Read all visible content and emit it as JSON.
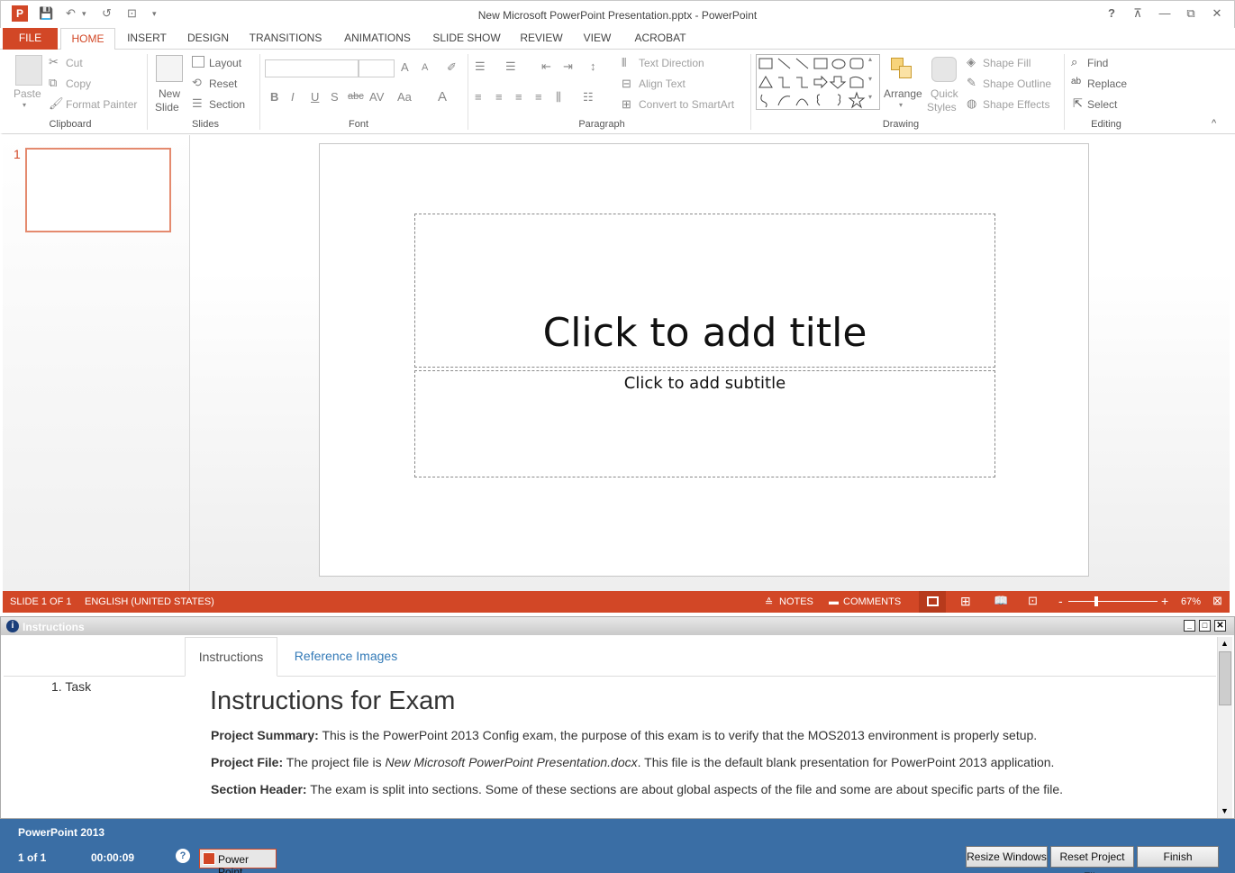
{
  "window": {
    "title": "New Microsoft PowerPoint Presentation.pptx - PowerPoint",
    "help": "?",
    "ribbon_display": "⊼",
    "minimize": "—",
    "restore": "⧉",
    "close": "✕"
  },
  "qat": {
    "app": "P",
    "save": "💾",
    "undo": "↶",
    "undo_arrow": "▾",
    "redo": "↺",
    "present": "⊡",
    "customize": "▾"
  },
  "tabs": [
    {
      "label": "FILE"
    },
    {
      "label": "HOME"
    },
    {
      "label": "INSERT"
    },
    {
      "label": "DESIGN"
    },
    {
      "label": "TRANSITIONS"
    },
    {
      "label": "ANIMATIONS"
    },
    {
      "label": "SLIDE SHOW"
    },
    {
      "label": "REVIEW"
    },
    {
      "label": "VIEW"
    },
    {
      "label": "ACROBAT"
    }
  ],
  "ribbon": {
    "clipboard": {
      "paste": "Paste",
      "cut": "Cut",
      "copy": "Copy",
      "format_painter": "Format Painter",
      "group": "Clipboard"
    },
    "slides": {
      "new_slide_line1": "New",
      "new_slide_line2": "Slide",
      "layout": "Layout",
      "reset": "Reset",
      "section": "Section",
      "group": "Slides"
    },
    "font": {
      "group": "Font",
      "bold": "B",
      "italic": "I",
      "underline": "U",
      "shadow": "S",
      "strike": "abc",
      "spacing": "AV",
      "case": "Aa",
      "color": "A",
      "grow": "A",
      "shrink": "A",
      "clear": "✐"
    },
    "paragraph": {
      "text_direction": "Text Direction",
      "align_text": "Align Text",
      "smartart": "Convert to SmartArt",
      "group": "Paragraph"
    },
    "drawing": {
      "arrange": "Arrange",
      "quick_styles_line1": "Quick",
      "quick_styles_line2": "Styles",
      "shape_fill": "Shape Fill",
      "shape_outline": "Shape Outline",
      "shape_effects": "Shape Effects",
      "group": "Drawing"
    },
    "editing": {
      "find": "Find",
      "replace": "Replace",
      "select": "Select",
      "group": "Editing"
    },
    "collapse": "^"
  },
  "thumbnails": [
    {
      "number": "1"
    }
  ],
  "slide": {
    "title_placeholder": "Click to add title",
    "subtitle_placeholder": "Click to add subtitle"
  },
  "status": {
    "slide": "SLIDE 1 OF 1",
    "language": "ENGLISH (UNITED STATES)",
    "notes": "NOTES",
    "comments": "COMMENTS",
    "zoom": "67%",
    "zoom_minus": "-",
    "zoom_plus": "+"
  },
  "instructions": {
    "header": "Instructions",
    "tabs": [
      "Instructions",
      "Reference Images"
    ],
    "tasks": [
      "1.  Task"
    ],
    "heading": "Instructions for Exam",
    "summary_label": "Project Summary:",
    "summary_text": " This is the PowerPoint 2013 Config exam, the purpose of this exam is to verify that the MOS2013 environment is properly setup.",
    "file_label": "Project File:",
    "file_text_pre": " The project file is ",
    "file_name": "New Microsoft PowerPoint Presentation.docx",
    "file_text_post": ". This file is the default blank presentation for PowerPoint 2013 application.",
    "section_label": "Section Header:",
    "section_text": " The exam is split into sections. Some of these sections are about global aspects of the file and some are about specific parts of the file."
  },
  "footer": {
    "app_name": "PowerPoint 2013",
    "progress": "1 of 1",
    "timer": "00:00:09",
    "taskbar_item": "Power Point",
    "resize_windows": "Resize Windows",
    "reset_project": "Reset Project File",
    "finish": "Finish"
  },
  "colors": {
    "accent": "#d24726",
    "footer": "#3a6ea5",
    "link": "#337ab7"
  }
}
